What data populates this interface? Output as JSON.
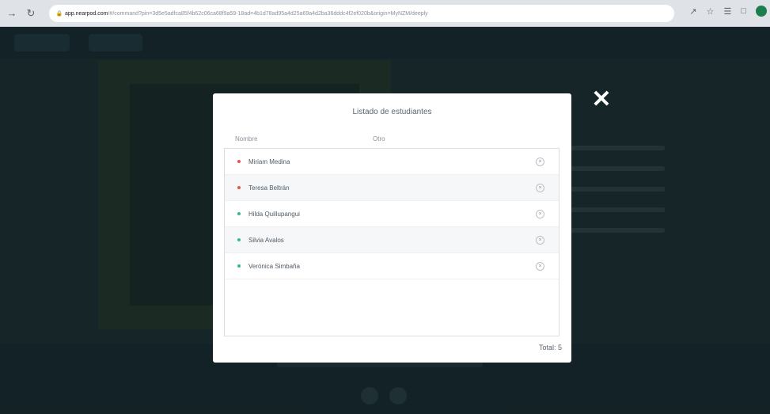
{
  "browser": {
    "url_host": "app.nearpod.com",
    "url_path": "/#/command?pin=3d5e5adfca85f4b62c06ca68f9a59-18ad=4b1d78ad95a4d25a69a4d2ba36dddc4f2ef020b&origin=MyNZM/deeply"
  },
  "modal": {
    "title": "Listado de estudiantes",
    "col_name": "Nombre",
    "col_other": "Otro",
    "total": "Total: 5",
    "students": [
      {
        "name": "Miriam Medina",
        "status_color": "#e2574c"
      },
      {
        "name": "Teresa Beltrán",
        "status_color": "#e2574c"
      },
      {
        "name": "Hilda Quillupangui",
        "status_color": "#3fb58f"
      },
      {
        "name": "Silvia Avalos",
        "status_color": "#3fb58f"
      },
      {
        "name": "Verónica Simbaña",
        "status_color": "#3fb58f"
      }
    ]
  },
  "icons": {
    "close": "close-icon",
    "remove": "remove-circle-icon"
  }
}
